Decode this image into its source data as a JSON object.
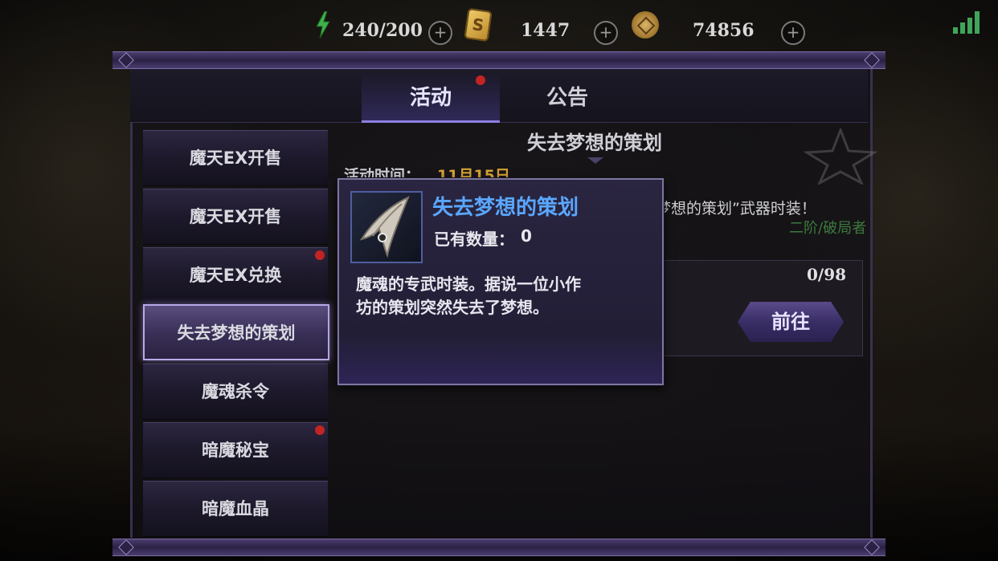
{
  "resources": {
    "energy": "240/200",
    "coin_icon_glyph": "S",
    "coins": "1447",
    "gold": "74856",
    "plus_label": "+"
  },
  "tabs": [
    {
      "label": "活动",
      "active": true,
      "has_notification": true
    },
    {
      "label": "公告",
      "active": false,
      "has_notification": false
    }
  ],
  "sidebar": {
    "items": [
      {
        "label": "魔天EX开售",
        "selected": false,
        "has_notification": false
      },
      {
        "label": "魔天EX开售",
        "selected": false,
        "has_notification": false
      },
      {
        "label": "魔天EX兑换",
        "selected": false,
        "has_notification": true
      },
      {
        "label": "失去梦想的策划",
        "selected": true,
        "has_notification": false
      },
      {
        "label": "魔魂杀令",
        "selected": false,
        "has_notification": false
      },
      {
        "label": "暗魔秘宝",
        "selected": false,
        "has_notification": true
      },
      {
        "label": "暗魔血晶",
        "selected": false,
        "has_notification": false
      }
    ]
  },
  "content": {
    "title": "失去梦想的策划",
    "time_label": "活动时间：",
    "time_value": "11月15日",
    "description_fragment": "梦想的策划”武器时装！",
    "tag_fragment": "二阶/破局者",
    "progress": "0/98",
    "go_button": "前往"
  },
  "tooltip": {
    "item_name": "失去梦想的策划",
    "owned_label": "已有数量：",
    "owned_value": "0",
    "description_line1": "魔魂的专武时装。据说一位小作",
    "description_line2": "坊的策划突然失去了梦想。"
  },
  "colors": {
    "accent_purple": "#8b7fe0",
    "notification_red": "#c22424",
    "tooltip_title_blue": "#5aa7ff",
    "time_gold": "#d6a335",
    "tag_green": "#3d7a3e",
    "signal_green": "#3fa55a"
  },
  "icons": {
    "energy": "lightning-bolt-icon",
    "coin": "coin-card-icon",
    "gold": "gold-coin-icon",
    "signal": "signal-bars-icon",
    "item": "dagger-blade-icon"
  }
}
